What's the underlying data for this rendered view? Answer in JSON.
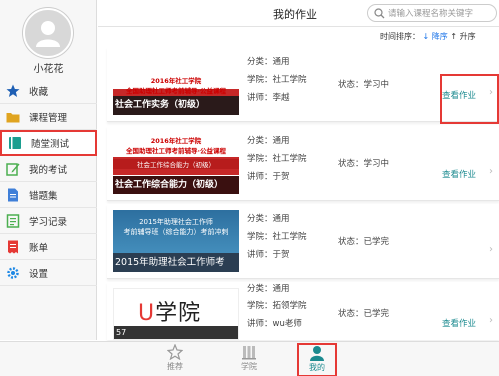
{
  "sidebar": {
    "username": "小花花",
    "items": [
      {
        "label": "收藏",
        "icon": "star-icon",
        "color": "#1e5fb4"
      },
      {
        "label": "课程管理",
        "icon": "folder-icon",
        "color": "#e0a420"
      },
      {
        "label": "随堂测试",
        "icon": "book-icon",
        "color": "#1b9e8f"
      },
      {
        "label": "我的考试",
        "icon": "edit-icon",
        "color": "#4caf50"
      },
      {
        "label": "错题集",
        "icon": "document-icon",
        "color": "#3f7fd8"
      },
      {
        "label": "学习记录",
        "icon": "record-icon",
        "color": "#4caf50"
      },
      {
        "label": "账单",
        "icon": "bill-icon",
        "color": "#e53935"
      },
      {
        "label": "设置",
        "icon": "gear-icon",
        "color": "#1e88e5"
      }
    ]
  },
  "header": {
    "title": "我的作业",
    "search_placeholder": "请输入课程名称关键字"
  },
  "sort": {
    "label": "时间排序：",
    "asc": "↓ 降序",
    "desc": "↑ 升序"
  },
  "courses": [
    {
      "thumb_title": "2016年社工学院\n全国助理社工师考前辅导·公益课程",
      "thumb_band": "社会工作实务（初级）",
      "category": "分类：通用",
      "college": "学院：社工学院",
      "teacher": "讲师：李越",
      "status": "状态：学习中",
      "action": "查看作业"
    },
    {
      "thumb_title": "2016年社工学院\n全国助理社工师考前辅导·公益课程",
      "thumb_sub": "社会工作综合能力（初级）",
      "thumb_band": "社会工作综合能力（初级）",
      "category": "分类：通用",
      "college": "学院：社工学院",
      "teacher": "讲师：于贺",
      "status": "状态：学习中",
      "action": "查看作业"
    },
    {
      "thumb_title": "2015年助理社会工作师\n考前辅导班（综合能力）考前冲刺",
      "thumb_band": "2015年助理社会工作师考",
      "category": "分类：通用",
      "college": "学院：社工学院",
      "teacher": "讲师：于贺",
      "status": "状态：已学完",
      "action": ""
    },
    {
      "thumb_logo_u": "U",
      "thumb_logo_text": "学院",
      "thumb_band": "57",
      "category": "分类：通用",
      "college": "学院：拓领学院",
      "teacher": "讲师：wu老师",
      "status": "状态：已学完",
      "action": "查看作业"
    }
  ],
  "tabs": [
    {
      "label": "推荐",
      "icon": "recommend-icon"
    },
    {
      "label": "学院",
      "icon": "college-icon"
    },
    {
      "label": "我的",
      "icon": "user-icon",
      "active": true
    }
  ],
  "colors": {
    "accent": "#1b8a8f",
    "highlight": "#e53935"
  }
}
